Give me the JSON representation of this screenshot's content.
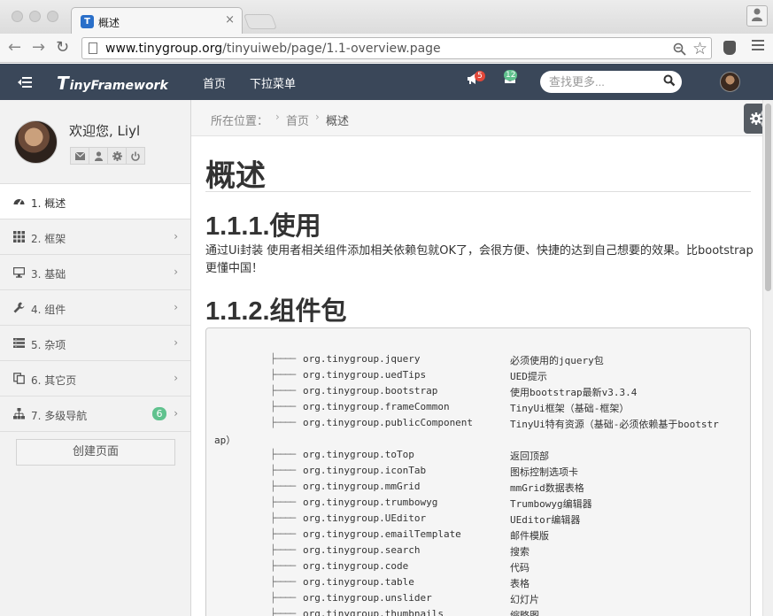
{
  "browser": {
    "tab_title": "概述",
    "tab_close": "×",
    "url_host": "www.tinygroup.org",
    "url_path": "/tinyuiweb/page/1.1-overview.page"
  },
  "navbar": {
    "brand_initial": "T",
    "brand_rest": "inyFramework",
    "links": [
      "首页",
      "下拉菜单"
    ],
    "notifications_count": "5",
    "messages_count": "12",
    "search_placeholder": "查找更多...",
    "colors": {
      "background": "#3a4759",
      "notification_badge": "#e2483a",
      "message_badge": "#60c28e"
    }
  },
  "sidebar": {
    "welcome_prefix": "欢迎您, ",
    "username": "Liyl",
    "menu": [
      {
        "label": "1. 概述",
        "icon": "dashboard-icon",
        "active": true
      },
      {
        "label": "2. 框架",
        "icon": "grid-icon"
      },
      {
        "label": "3. 基础",
        "icon": "desktop-icon"
      },
      {
        "label": "4. 组件",
        "icon": "wrench-icon"
      },
      {
        "label": "5. 杂项",
        "icon": "list-icon"
      },
      {
        "label": "6. 其它页",
        "icon": "copy-icon"
      },
      {
        "label": "7. 多级导航",
        "icon": "sitemap-icon",
        "badge": "6"
      }
    ],
    "create_button": "创建页面"
  },
  "breadcrumb": {
    "prefix": "所在位置：",
    "items": [
      "首页",
      "概述"
    ]
  },
  "content": {
    "title": "概述",
    "section1_heading": "1.1.1.使用",
    "section1_text": "通过Ui封装 使用者相关组件添加相关依赖包就OK了，会很方便、快捷的达到自己想要的效果。比bootstrap更懂中国！",
    "section2_heading": "1.1.2.组件包",
    "tree_branch": "├────",
    "packages": [
      {
        "name": "org.tinygroup.jquery",
        "desc": "必须使用的jquery包"
      },
      {
        "name": "org.tinygroup.uedTips",
        "desc": "UED提示"
      },
      {
        "name": "org.tinygroup.bootstrap",
        "desc": "使用bootstrap最新v3.3.4"
      },
      {
        "name": "org.tinygroup.frameCommon",
        "desc": "TinyUi框架（基础-框架）"
      },
      {
        "name": "org.tinygroup.publicComponent",
        "desc": "TinyUi特有资源（基础-必须依赖基于bootstr",
        "wrap": "ap）"
      },
      {
        "name": "org.tinygroup.toTop",
        "desc": "返回顶部"
      },
      {
        "name": "org.tinygroup.iconTab",
        "desc": "图标控制选项卡"
      },
      {
        "name": "org.tinygroup.mmGrid",
        "desc": "mmGrid数据表格"
      },
      {
        "name": "org.tinygroup.trumbowyg",
        "desc": "Trumbowyg编辑器"
      },
      {
        "name": "org.tinygroup.UEditor",
        "desc": "UEditor编辑器"
      },
      {
        "name": "org.tinygroup.emailTemplate",
        "desc": "邮件模版"
      },
      {
        "name": "org.tinygroup.search",
        "desc": "搜索"
      },
      {
        "name": "org.tinygroup.code",
        "desc": "代码"
      },
      {
        "name": "org.tinygroup.table",
        "desc": "表格"
      },
      {
        "name": "org.tinygroup.unslider",
        "desc": "幻灯片"
      },
      {
        "name": "org.tinygroup.thumbnails",
        "desc": "缩略图"
      }
    ]
  }
}
